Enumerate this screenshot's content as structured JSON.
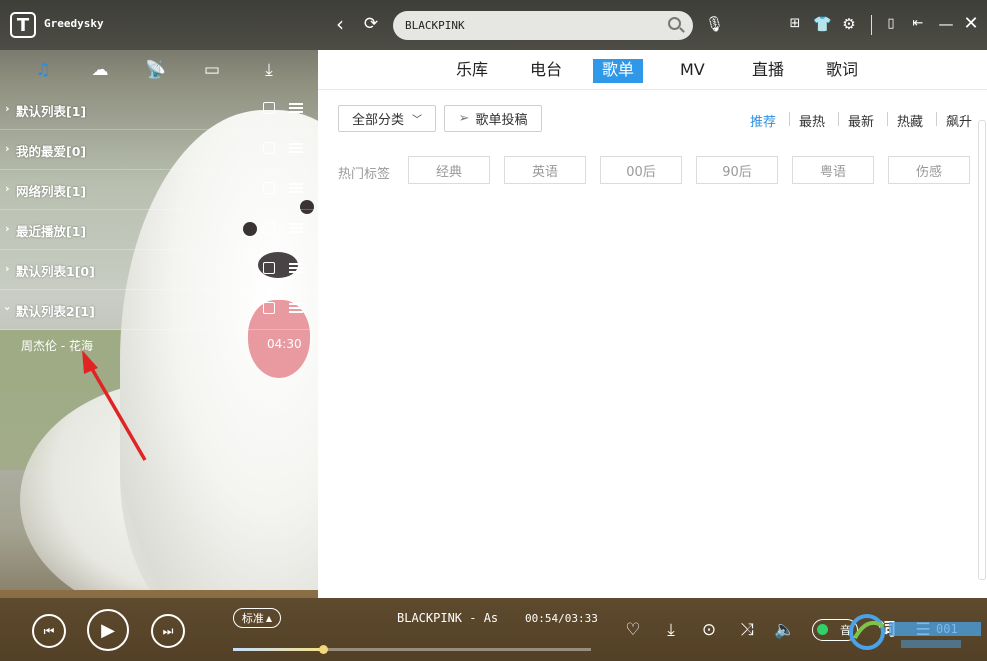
{
  "app": {
    "user": "Greedysky",
    "logo_letter": "T"
  },
  "search": {
    "value": "BLACKPINK"
  },
  "sidebar": {
    "playlists": [
      {
        "name": "默认列表[1]",
        "expanded": false
      },
      {
        "name": "我的最爱[0]",
        "expanded": false
      },
      {
        "name": "网络列表[1]",
        "expanded": false
      },
      {
        "name": "最近播放[1]",
        "expanded": false
      },
      {
        "name": "默认列表1[0]",
        "expanded": false
      },
      {
        "name": "默认列表2[1]",
        "expanded": true
      }
    ],
    "song": {
      "title": "周杰伦 - 花海",
      "duration": "04:30"
    }
  },
  "tabs": [
    "乐库",
    "电台",
    "歌单",
    "MV",
    "直播",
    "歌词"
  ],
  "active_tab": "歌单",
  "filters": {
    "category_label": "全部分类",
    "submit_label": "歌单投稿",
    "sort": [
      "推荐",
      "最热",
      "最新",
      "热藏",
      "飙升"
    ],
    "active_sort": "推荐"
  },
  "hot_tags": {
    "label": "热门标签",
    "items": [
      "经典",
      "英语",
      "00后",
      "90后",
      "粤语",
      "伤感"
    ]
  },
  "player": {
    "quality": "标准",
    "track": "BLACKPINK - As",
    "time": "00:54/03:33",
    "progress": 0.25,
    "lyric_label": "词",
    "toggle_label": "音",
    "count": "001"
  },
  "colors": {
    "accent": "#2f98e8"
  }
}
